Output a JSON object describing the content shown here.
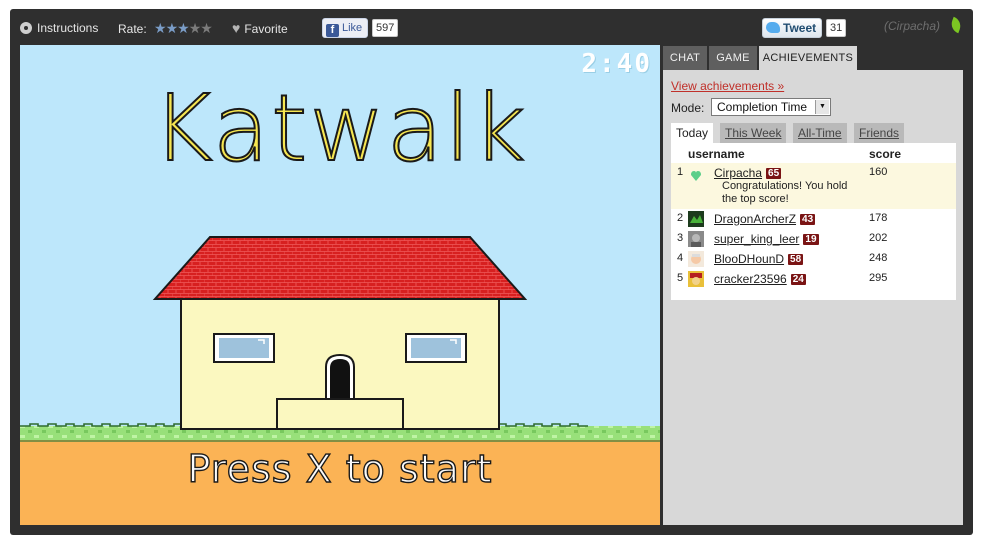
{
  "topbar": {
    "instructions_label": "Instructions",
    "rate_label": "Rate:",
    "rating_stars": 3,
    "rating_max": 5,
    "favorite_label": "Favorite",
    "like_label": "Like",
    "like_count": "597",
    "tweet_label": "Tweet",
    "tweet_count": "31",
    "username": "(Cirpacha)"
  },
  "game": {
    "timer": "2:40",
    "title": "Katwalk",
    "prompt": "Press X to start",
    "colors": {
      "sky": "#bde7fb",
      "ground": "#fbb355",
      "grass": "#98e07a",
      "roof": "#d72020",
      "wall": "#fbf8c0"
    }
  },
  "side_tabs": [
    {
      "label": "CHAT",
      "active": false
    },
    {
      "label": "GAME",
      "active": false
    },
    {
      "label": "ACHIEVEMENTS",
      "active": true
    }
  ],
  "achievements": {
    "view_link": "View achievements »",
    "mode_label": "Mode:",
    "mode_value": "Completion Time",
    "period_tabs": [
      {
        "label": "Today",
        "active": true
      },
      {
        "label": "This Week",
        "active": false
      },
      {
        "label": "All-Time",
        "active": false
      },
      {
        "label": "Friends",
        "active": false
      }
    ],
    "columns": {
      "username": "username",
      "score": "score"
    },
    "rows": [
      {
        "rank": "1",
        "username": "Cirpacha",
        "level": "65",
        "score": "160",
        "note": "Congratulations! You hold the top score!"
      },
      {
        "rank": "2",
        "username": "DragonArcherZ",
        "level": "43",
        "score": "178"
      },
      {
        "rank": "3",
        "username": "super_king_leer",
        "level": "19",
        "score": "202"
      },
      {
        "rank": "4",
        "username": "BlooDHounD",
        "level": "58",
        "score": "248"
      },
      {
        "rank": "5",
        "username": "cracker23596",
        "level": "24",
        "score": "295"
      }
    ]
  }
}
